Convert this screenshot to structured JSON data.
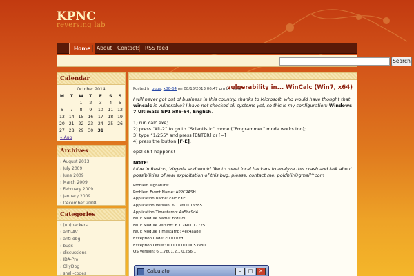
{
  "site": {
    "title": "KPNC",
    "tagline": "reversing lab"
  },
  "nav": {
    "items": [
      "Home",
      "About",
      "Contacts",
      "RSS feed"
    ],
    "active": "Home"
  },
  "search": {
    "button_label": "Search",
    "placeholder": ""
  },
  "calendar": {
    "title": "Calendar",
    "caption": "October 2014",
    "weekdays": [
      "M",
      "T",
      "W",
      "T",
      "F",
      "S",
      "S"
    ],
    "weeks": [
      [
        "",
        "",
        "1",
        "2",
        "3",
        "4",
        "5"
      ],
      [
        "6",
        "7",
        "8",
        "9",
        "10",
        "11",
        "12"
      ],
      [
        "13",
        "14",
        "15",
        "16",
        "17",
        "18",
        "19"
      ],
      [
        "20",
        "21",
        "22",
        "23",
        "24",
        "25",
        "26"
      ],
      [
        "27",
        "28",
        "29",
        "30",
        "31",
        "",
        ""
      ]
    ],
    "prev_link": "« Aug"
  },
  "archives": {
    "title": "Archives",
    "items": [
      "August 2013",
      "July 2009",
      "June 2009",
      "March 2009",
      "February 2009",
      "January 2009",
      "December 2008"
    ]
  },
  "categories": {
    "title": "Categories",
    "items": [
      "(un)packers",
      "anti-AV",
      "anti-dbg",
      "bugs",
      "discussions",
      "IDA-Pro",
      "OllyDbg",
      "shell-codes"
    ]
  },
  "post": {
    "title": "vulnerability in... WinCalc (Win7, x64)",
    "meta_posted": "Posted in",
    "meta_cat1": "bugs",
    "meta_cat2": "x86-64",
    "meta_rest": "on 08/15/2013 06:47 pm by kpnc",
    "p1a": "I will never got out of business in this country, thanks to Microsoft. who would have thought that ",
    "p1b": "wincalc",
    "p1c": " is vulnerable? I have not checked all systems yet, so this is my configuration: ",
    "p1d": "Windows 7 Ultimate SP1 x86-64, English",
    "p1e": ".",
    "steps": [
      "1) run calc.exe;",
      "2) press “Alt-2” to go to “Scientistic” mode (“Programmer” mode works too);",
      "3) type “1/255” and press [ENTER] or [=]"
    ],
    "step4a": "4) press the button ",
    "step4b": "[F-E]",
    "step4c": ".",
    "oops": "ops! shit happens!",
    "note_label": "NOTE:",
    "note_text": "I live in Reston, Virginia and would like to meet local hackers to analyze this crash and talk about possibilities of real exploitation of this bug. please, contact me: poldhiir@gmail^com",
    "signature": [
      "Problem signature:",
      "Problem Event Name: APPCRASH",
      "Application Name: calc.EXE",
      "Application Version: 6.1.7600.16385",
      "Application Timestamp: 4a5bc9d4",
      "Fault Module Name: ntdll.dll",
      "Fault Module Version: 6.1.7601.17725",
      "Fault Module Timestamp: 4ec4aa8e",
      "Exception Code: c00000fd",
      "Exception Offset: 0000000000053980",
      "OS Version: 6.1.7601.2.1.0.256.1"
    ]
  },
  "calc_window": {
    "title": "Calculator"
  }
}
